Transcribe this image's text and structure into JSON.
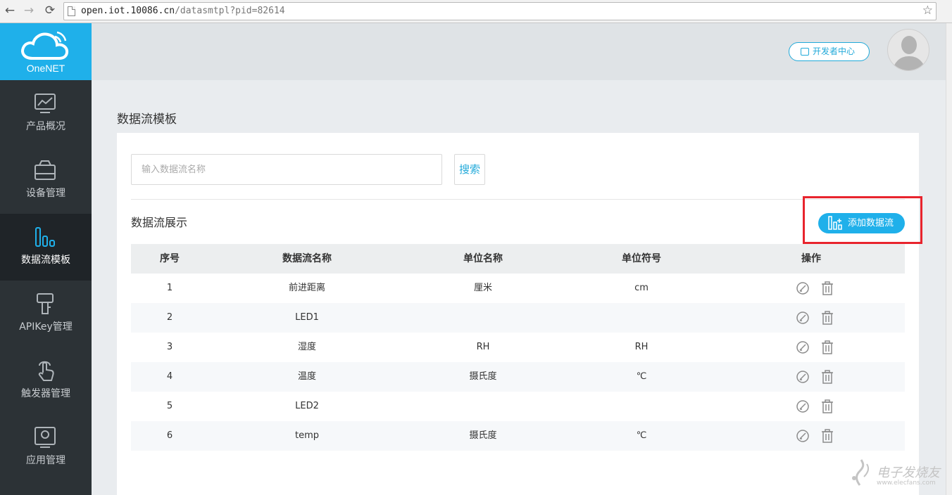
{
  "browser": {
    "url_host": "open.iot.10086.cn",
    "url_path": "/datasmtpl?pid=82614",
    "back_icon": "back-arrow-icon",
    "forward_icon": "forward-arrow-icon",
    "reload_icon": "reload-icon"
  },
  "brand": {
    "name": "OneNET",
    "color": "#1fb0ea"
  },
  "sidebar": {
    "items": [
      {
        "label": "产品概况",
        "icon": "chart-icon"
      },
      {
        "label": "设备管理",
        "icon": "device-icon"
      },
      {
        "label": "数据流模板",
        "icon": "datastream-icon",
        "active": true
      },
      {
        "label": "APIKey管理",
        "icon": "key-icon"
      },
      {
        "label": "触发器管理",
        "icon": "touch-icon"
      },
      {
        "label": "应用管理",
        "icon": "app-icon"
      }
    ]
  },
  "header": {
    "dev_center": "开发者中心"
  },
  "main": {
    "title": "数据流模板",
    "search_placeholder": "输入数据流名称",
    "search_button": "搜索",
    "section_title": "数据流展示",
    "add_button": "添加数据流"
  },
  "table": {
    "columns": [
      "序号",
      "数据流名称",
      "单位名称",
      "单位符号",
      "操作"
    ],
    "rows": [
      [
        "1",
        "前进距离",
        "厘米",
        "cm"
      ],
      [
        "2",
        "LED1",
        "",
        ""
      ],
      [
        "3",
        "湿度",
        "RH",
        "RH"
      ],
      [
        "4",
        "温度",
        "摄氏度",
        "℃"
      ],
      [
        "5",
        "LED2",
        "",
        ""
      ],
      [
        "6",
        "temp",
        "摄氏度",
        "℃"
      ]
    ]
  },
  "watermark": {
    "text": "电子发烧友",
    "url": "www.elecfans.com"
  },
  "colors": {
    "accent": "#1fb0ea",
    "highlight": "#e8242d",
    "sidebar": "#2c3236"
  }
}
